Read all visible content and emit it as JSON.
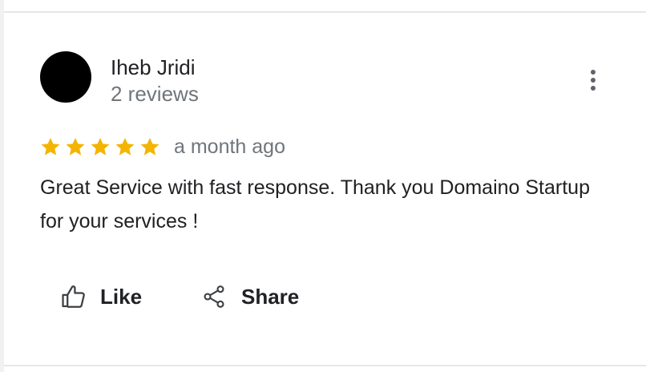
{
  "review": {
    "author_name": "Iheb Jridi",
    "author_reviews": "2 reviews",
    "rating": 5,
    "rating_max": 5,
    "time": "a month ago",
    "text": "Great Service with fast response. Thank you Domaino Startup for your services !"
  },
  "actions": {
    "like_label": "Like",
    "share_label": "Share"
  },
  "icons": {
    "more": "more-vert-icon",
    "like": "thumb-up-icon",
    "share": "share-icon",
    "star": "star-icon"
  },
  "colors": {
    "star": "#f4b400",
    "text": "#202124",
    "secondary": "#70757a"
  }
}
